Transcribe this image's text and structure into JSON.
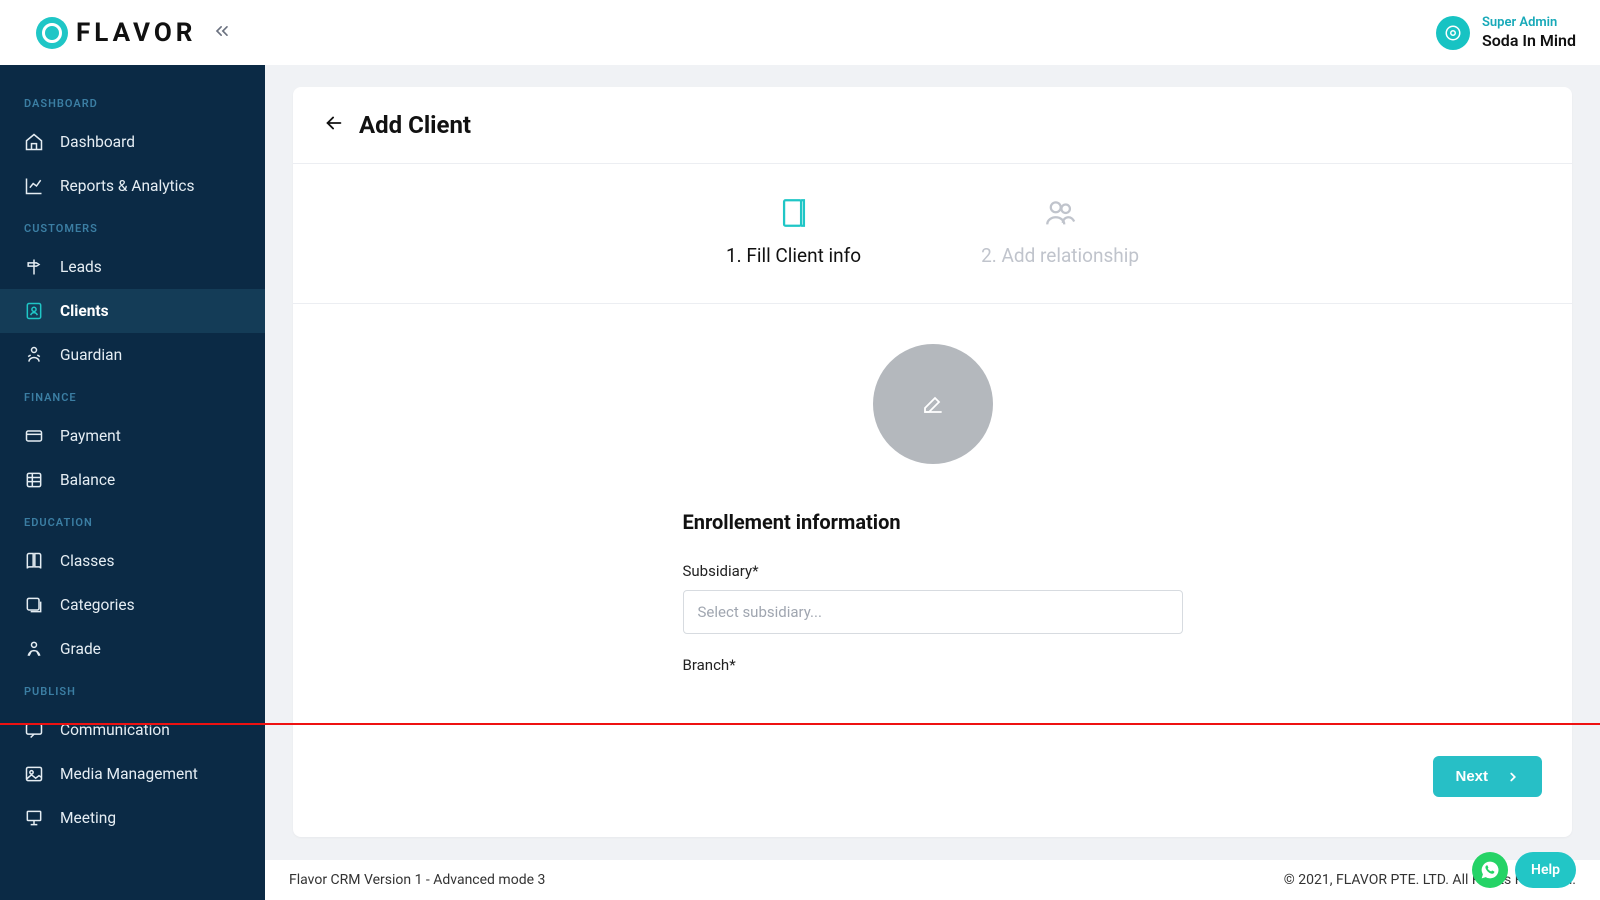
{
  "brand": {
    "name": "FLAVOR"
  },
  "user": {
    "role": "Super Admin",
    "name": "Soda In Mind"
  },
  "sidebar": {
    "sections": [
      {
        "title": "DASHBOARD",
        "items": [
          {
            "label": "Dashboard",
            "icon": "home"
          },
          {
            "label": "Reports & Analytics",
            "icon": "chart"
          }
        ]
      },
      {
        "title": "CUSTOMERS",
        "items": [
          {
            "label": "Leads",
            "icon": "leads"
          },
          {
            "label": "Clients",
            "icon": "client",
            "active": true
          },
          {
            "label": "Guardian",
            "icon": "guardian"
          }
        ]
      },
      {
        "title": "FINANCE",
        "items": [
          {
            "label": "Payment",
            "icon": "card"
          },
          {
            "label": "Balance",
            "icon": "sheet"
          }
        ]
      },
      {
        "title": "EDUCATION",
        "items": [
          {
            "label": "Classes",
            "icon": "book"
          },
          {
            "label": "Categories",
            "icon": "stack"
          },
          {
            "label": "Grade",
            "icon": "grade"
          }
        ]
      },
      {
        "title": "PUBLISH",
        "items": [
          {
            "label": "Communication",
            "icon": "chat"
          },
          {
            "label": "Media Management",
            "icon": "image"
          },
          {
            "label": "Meeting",
            "icon": "meet"
          }
        ]
      }
    ]
  },
  "page": {
    "title": "Add Client",
    "steps": {
      "one": "1. Fill Client info",
      "two": "2. Add relationship"
    },
    "section_title": "Enrollement information",
    "fields": {
      "subsidiary_label": "Subsidiary*",
      "subsidiary_placeholder": "Select subsidiary...",
      "branch_label": "Branch*"
    },
    "next_label": "Next"
  },
  "footer": {
    "left": "Flavor CRM Version 1 - Advanced mode 3",
    "right": "© 2021, FLAVOR PTE. LTD. All Rights Reserved."
  },
  "help_label": "Help"
}
